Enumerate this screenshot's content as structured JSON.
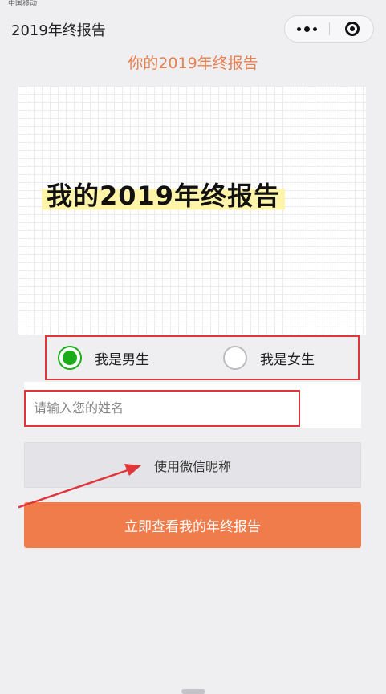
{
  "status_bar": {
    "carrier": "中国移动"
  },
  "nav": {
    "title": "2019年终报告",
    "more_icon": "more-dots-icon",
    "close_icon": "close-ring-icon"
  },
  "page": {
    "heading": "你的2019年终报告"
  },
  "banner": {
    "title": "我的2019年终报告"
  },
  "gender": {
    "options": [
      {
        "label": "我是男生",
        "checked": true
      },
      {
        "label": "我是女生",
        "checked": false
      }
    ]
  },
  "name": {
    "placeholder": "请输入您的姓名",
    "value": ""
  },
  "buttons": {
    "wechat_nickname": "使用微信昵称",
    "submit": "立即查看我的年终报告"
  },
  "colors": {
    "accent": "#f07c4c",
    "heading": "#e8814f",
    "radio_checked": "#1aad19",
    "highlight_box": "#e0353a",
    "annotation_arrow": "#e0353a"
  }
}
